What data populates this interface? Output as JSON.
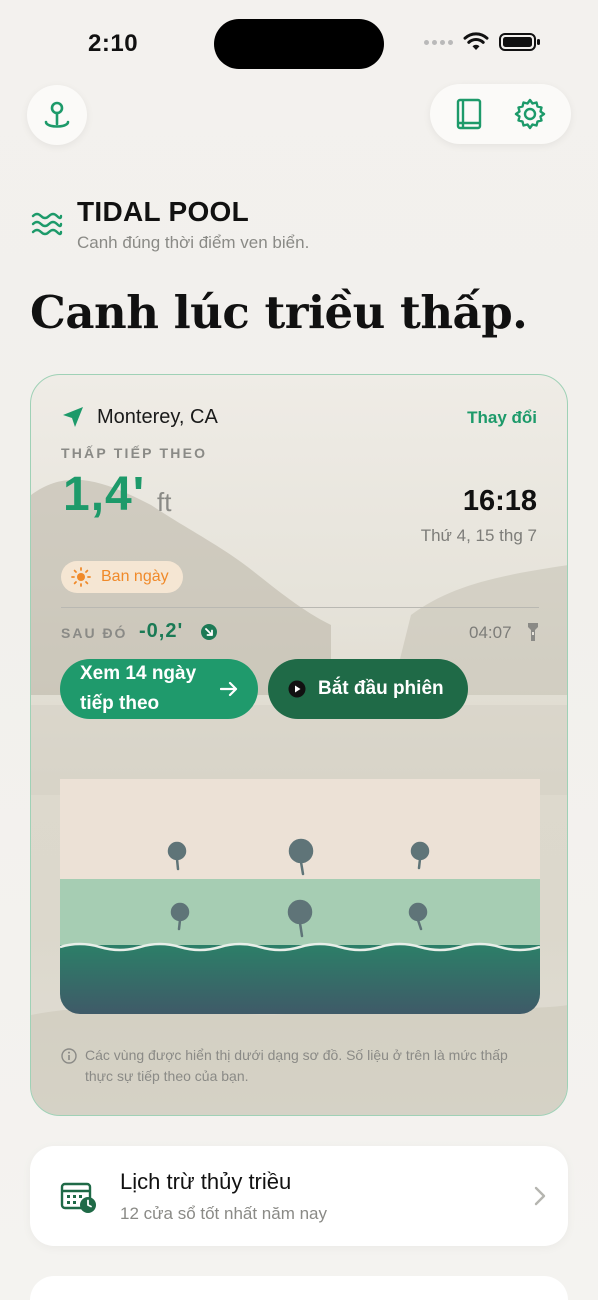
{
  "status": {
    "time": "2:10"
  },
  "header": {
    "map_pin_icon": "map-pin-icon",
    "book_icon": "book-icon",
    "settings_icon": "gear-icon"
  },
  "brand": {
    "title": "TIDAL POOL",
    "subtitle": "Canh đúng thời điểm ven biển.",
    "icon": "waves-icon"
  },
  "hero": {
    "title": "Canh lúc triều thấp."
  },
  "tide_card": {
    "location": "Monterey, CA",
    "change_label": "Thay đổi",
    "next_low_label": "THẤP TIẾP THEO",
    "height": "1,4'",
    "unit": "ft",
    "time": "16:18",
    "date": "Thứ 4, 15 thg 7",
    "daylight_label": "Ban ngày",
    "after_label": "SAU ĐÓ",
    "after_value": "-0,2'",
    "after_time": "04:07",
    "btn_days": "Xem 14 ngày tiếp theo",
    "btn_session": "Bắt đầu phiên",
    "info_text": "Các vùng được hiển thị dưới dạng sơ đồ. Số liệu ở trên là mức thấp thực sự tiếp theo của bạn.",
    "colors": {
      "accent": "#1f9a6c",
      "accent_dark": "#1f6a47",
      "daylight": "#f08a2a"
    }
  },
  "calendar": {
    "title": "Lịch trừ thủy triều",
    "subtitle": "12 cửa sổ tốt nhất năm nay"
  }
}
